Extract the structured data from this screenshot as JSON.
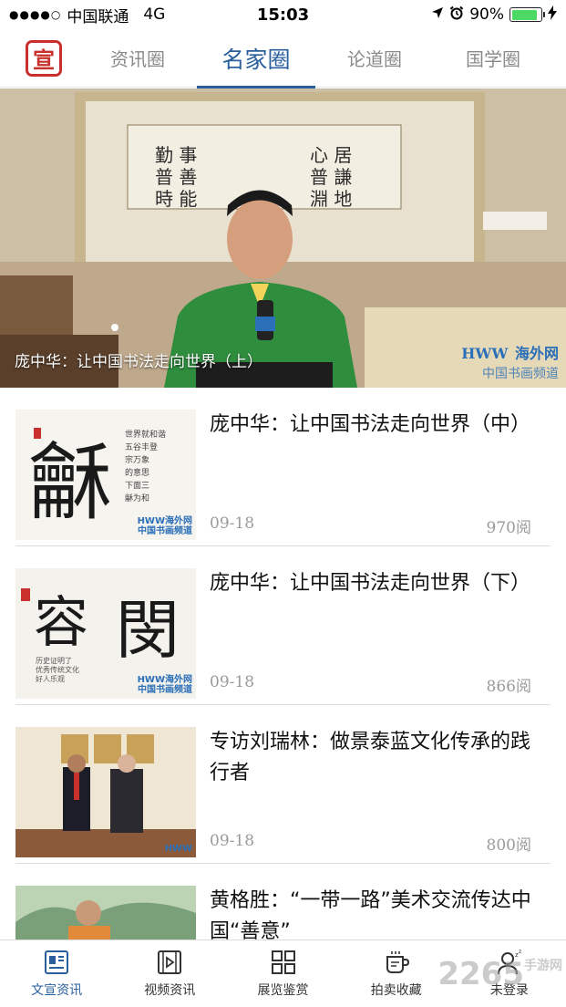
{
  "status_bar": {
    "carrier": "中国联通",
    "network": "4G",
    "time": "15:03",
    "battery": "90%",
    "battery_level": 0.9,
    "signal_dots": "●●●●○"
  },
  "top_nav": {
    "logo_char": "宣",
    "tabs": [
      {
        "label": "资讯圈"
      },
      {
        "label": "名家圈"
      },
      {
        "label": "论道圈"
      },
      {
        "label": "国学圈"
      }
    ],
    "active_tab": 1
  },
  "banner": {
    "caption": "庞中华：让中国书法走向世界（上）",
    "watermark_main": "HWW",
    "watermark_cn": "海外网",
    "watermark_sub": "中国书画频道"
  },
  "articles": [
    {
      "title": "庞中华：让中国书法走向世界（中）",
      "date": "09-18",
      "views": "970阅",
      "thumb_watermark": "HWW海外网",
      "thumb_sub": "中国书画频道"
    },
    {
      "title": "庞中华：让中国书法走向世界（下）",
      "date": "09-18",
      "views": "866阅",
      "thumb_watermark": "HWW海外网",
      "thumb_sub": "中国书画频道"
    },
    {
      "title": "专访刘瑞林：做景泰蓝文化传承的践行者",
      "date": "09-18",
      "views": "800阅",
      "thumb_watermark": "HWW",
      "thumb_sub": ""
    },
    {
      "title": "黄格胜：“一带一路”美术交流传达中国“善意”",
      "date": "",
      "views": "",
      "thumb_watermark": "",
      "thumb_sub": ""
    }
  ],
  "bottom_tabs": [
    {
      "label": "文宣资讯",
      "icon": "news-icon"
    },
    {
      "label": "视频资讯",
      "icon": "video-icon"
    },
    {
      "label": "展览鉴赏",
      "icon": "grid-icon"
    },
    {
      "label": "拍卖收藏",
      "icon": "cup-icon"
    },
    {
      "label": "未登录",
      "icon": "user-sleep-icon"
    }
  ],
  "site_watermark": {
    "main": "2265",
    "sub": "手游网"
  },
  "colors": {
    "accent": "#2a5f9e",
    "logo_red": "#c9302c",
    "battery_green": "#4cd964"
  }
}
